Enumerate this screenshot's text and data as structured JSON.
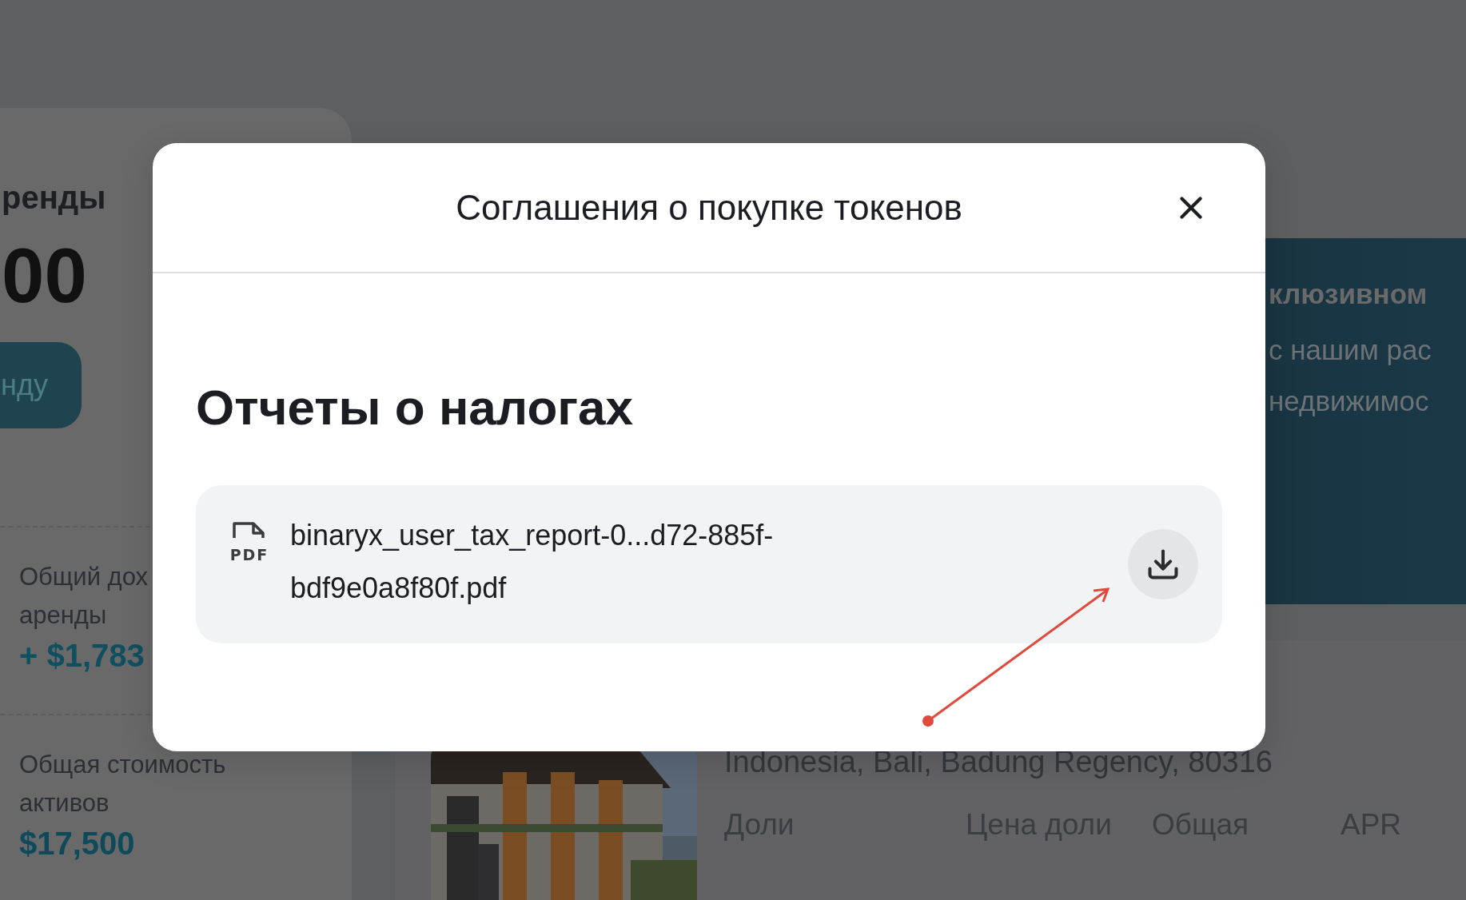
{
  "background": {
    "left_card": {
      "title": "ренды",
      "amount": "00",
      "button": "нду",
      "stats": [
        {
          "label_lines": [
            "Общий дох",
            "аренды"
          ],
          "value": "+ $1,783",
          "kind": "income"
        },
        {
          "label_lines": [
            "Общая стоимость",
            "активов"
          ],
          "value": "$17,500",
          "kind": "total"
        }
      ]
    },
    "promo_panel": {
      "title": "клюзивном",
      "text_lines": [
        "с нашим рас",
        "недвижимос"
      ]
    },
    "property_card": {
      "address": "Indonesia, Bali, Badung Regency, 80316",
      "columns": [
        "Доли",
        "Цена доли",
        "Общая",
        "APR"
      ]
    }
  },
  "modal": {
    "title": "Соглашения о покупке токенов",
    "section_title": "Отчеты о налогах",
    "files": [
      {
        "type": "PDF",
        "name": "binaryx_user_tax_report-0...d72-885f-bdf9e0a8f80f.pdf"
      }
    ]
  }
}
